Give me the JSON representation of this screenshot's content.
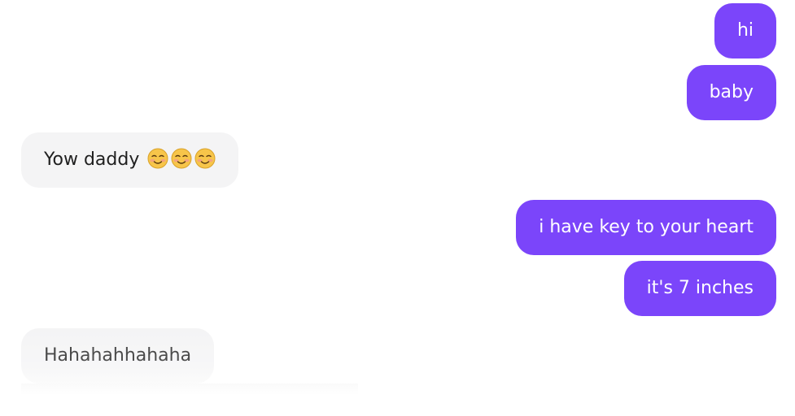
{
  "messages": [
    {
      "direction": "outgoing",
      "text": "hi"
    },
    {
      "direction": "outgoing",
      "text": "baby"
    },
    {
      "direction": "incoming",
      "text": "Yow daddy",
      "emoji_count": 3,
      "emoji": "smiling-face-icon"
    },
    {
      "direction": "outgoing",
      "text": "i have key to your heart"
    },
    {
      "direction": "outgoing",
      "text": "it's 7 inches"
    },
    {
      "direction": "incoming",
      "text": "Hahahahhahaha"
    }
  ],
  "colors": {
    "outgoing_bubble": "#7b45fa",
    "outgoing_text": "#ffffff",
    "incoming_bubble": "#f4f4f5",
    "incoming_text": "#1f1f1f"
  }
}
